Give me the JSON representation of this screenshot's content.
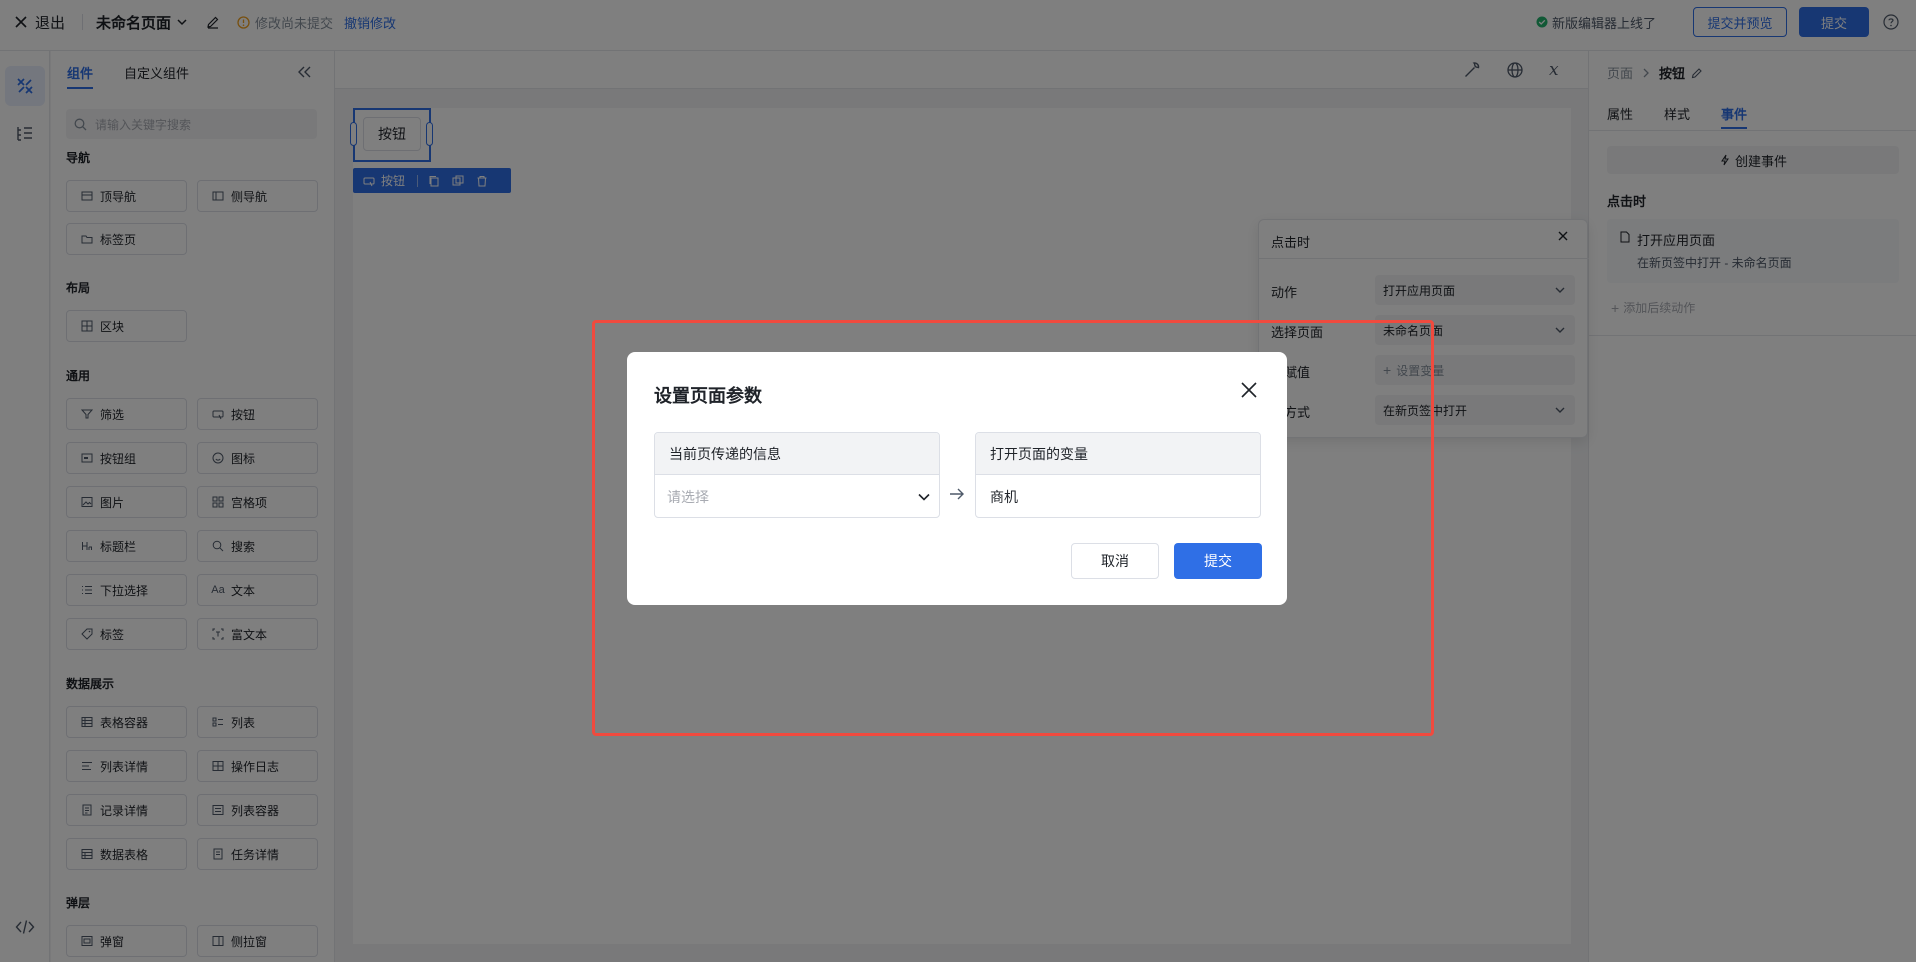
{
  "topbar": {
    "exit_label": "退出",
    "page_name": "未命名页面",
    "unsaved_text": "修改尚未提交",
    "undo_label": "撤销修改",
    "new_editor_text": "新版编辑器上线了",
    "submit_preview_label": "提交并预览",
    "submit_label": "提交"
  },
  "component_panel": {
    "tabs": [
      "组件",
      "自定义组件"
    ],
    "search_placeholder": "请输入关键字搜索",
    "sections": {
      "nav": "导航",
      "layout": "布局",
      "common": "通用",
      "data_display": "数据展示",
      "popup": "弹层"
    },
    "nav_items": [
      "顶导航",
      "侧导航",
      "标签页"
    ],
    "layout_items": [
      "区块"
    ],
    "common_items": [
      "筛选",
      "按钮",
      "按钮组",
      "图标",
      "图片",
      "宫格项",
      "标题栏",
      "搜索",
      "下拉选择",
      "文本",
      "标签",
      "富文本"
    ],
    "data_items": [
      "表格容器",
      "列表",
      "列表详情",
      "操作日志",
      "记录详情",
      "列表容器",
      "数据表格",
      "任务详情"
    ],
    "popup_items": [
      "弹窗",
      "侧拉窗"
    ]
  },
  "canvas": {
    "button_label": "按钮",
    "selected_tag": "按钮"
  },
  "right_panel": {
    "breadcrumb_root": "页面",
    "breadcrumb_current": "按钮",
    "tabs": [
      "属性",
      "样式",
      "事件"
    ],
    "create_event_label": "创建事件",
    "on_click_label": "点击时",
    "action_title": "打开应用页面",
    "action_desc": "在新页签中打开 - 未命名页面",
    "add_follow_label": "添加后续动作"
  },
  "event_popover": {
    "title": "点击时",
    "rows": [
      {
        "label": "动作",
        "value": "打开应用页面"
      },
      {
        "label": "选择页面",
        "value": "未命名页面"
      },
      {
        "label": "量赋值",
        "value": "设置变量"
      },
      {
        "label": "转方式",
        "value": "在新页签中打开"
      }
    ]
  },
  "dialog": {
    "title": "设置页面参数",
    "left_header": "当前页传递的信息",
    "left_placeholder": "请选择",
    "right_header": "打开页面的变量",
    "right_value": "商机",
    "cancel_label": "取消",
    "submit_label": "提交"
  },
  "colors": {
    "primary": "#2f6fe6",
    "primary_dark": "#1a4fb8",
    "highlight": "#f04a3e",
    "warning": "#f0a020",
    "success": "#23b26d"
  }
}
